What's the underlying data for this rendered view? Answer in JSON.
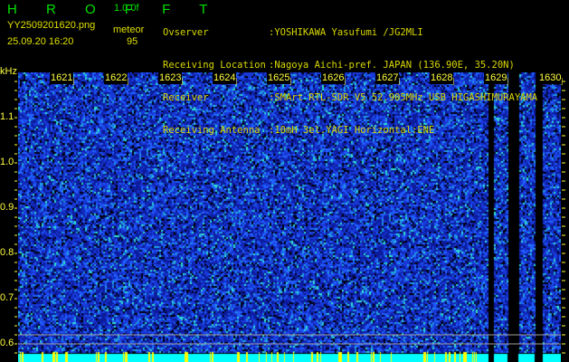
{
  "header": {
    "app_name": "H R O F F T",
    "version": "1.0.0f",
    "filename": "YY2509201620.png",
    "datetime": "25.09.20 16:20",
    "mode_label": "meteor",
    "meteor_count": "95",
    "info": [
      {
        "label": "Ovserver",
        "value": ":YOSHIKAWA Yasufumi /JG2MLI"
      },
      {
        "label": "Receiving Location",
        "value": ":Nagoya Aichi-pref. JAPAN (136.90E, 35.20N)"
      },
      {
        "label": "Receiver",
        "value": ":SMArt RTL-SDR V5 52.905MHz USB HIGASHIMURAYAMA"
      },
      {
        "label": "Receiving Antenna",
        "value": ":10mH 3el.YAGI Horizontal:ENE"
      }
    ]
  },
  "chart_data": {
    "type": "heatmap",
    "ylabel": "kHz",
    "x_ticks": [
      "1621",
      "1622",
      "1623",
      "1624",
      "1625",
      "1626",
      "1627",
      "1628",
      "1629",
      "1630"
    ],
    "y_ticks": [
      "1.1",
      "1.0",
      "0.9",
      "0.8",
      "0.7",
      "0.6"
    ],
    "ylim": [
      0.56,
      1.2
    ],
    "colors": {
      "background_noise": "#0a1aa8",
      "high": "#00ffff",
      "peak": "#ffff00",
      "gridline": "#a0a0a0"
    },
    "gridlines_khz": [
      0.62,
      0.6
    ]
  }
}
